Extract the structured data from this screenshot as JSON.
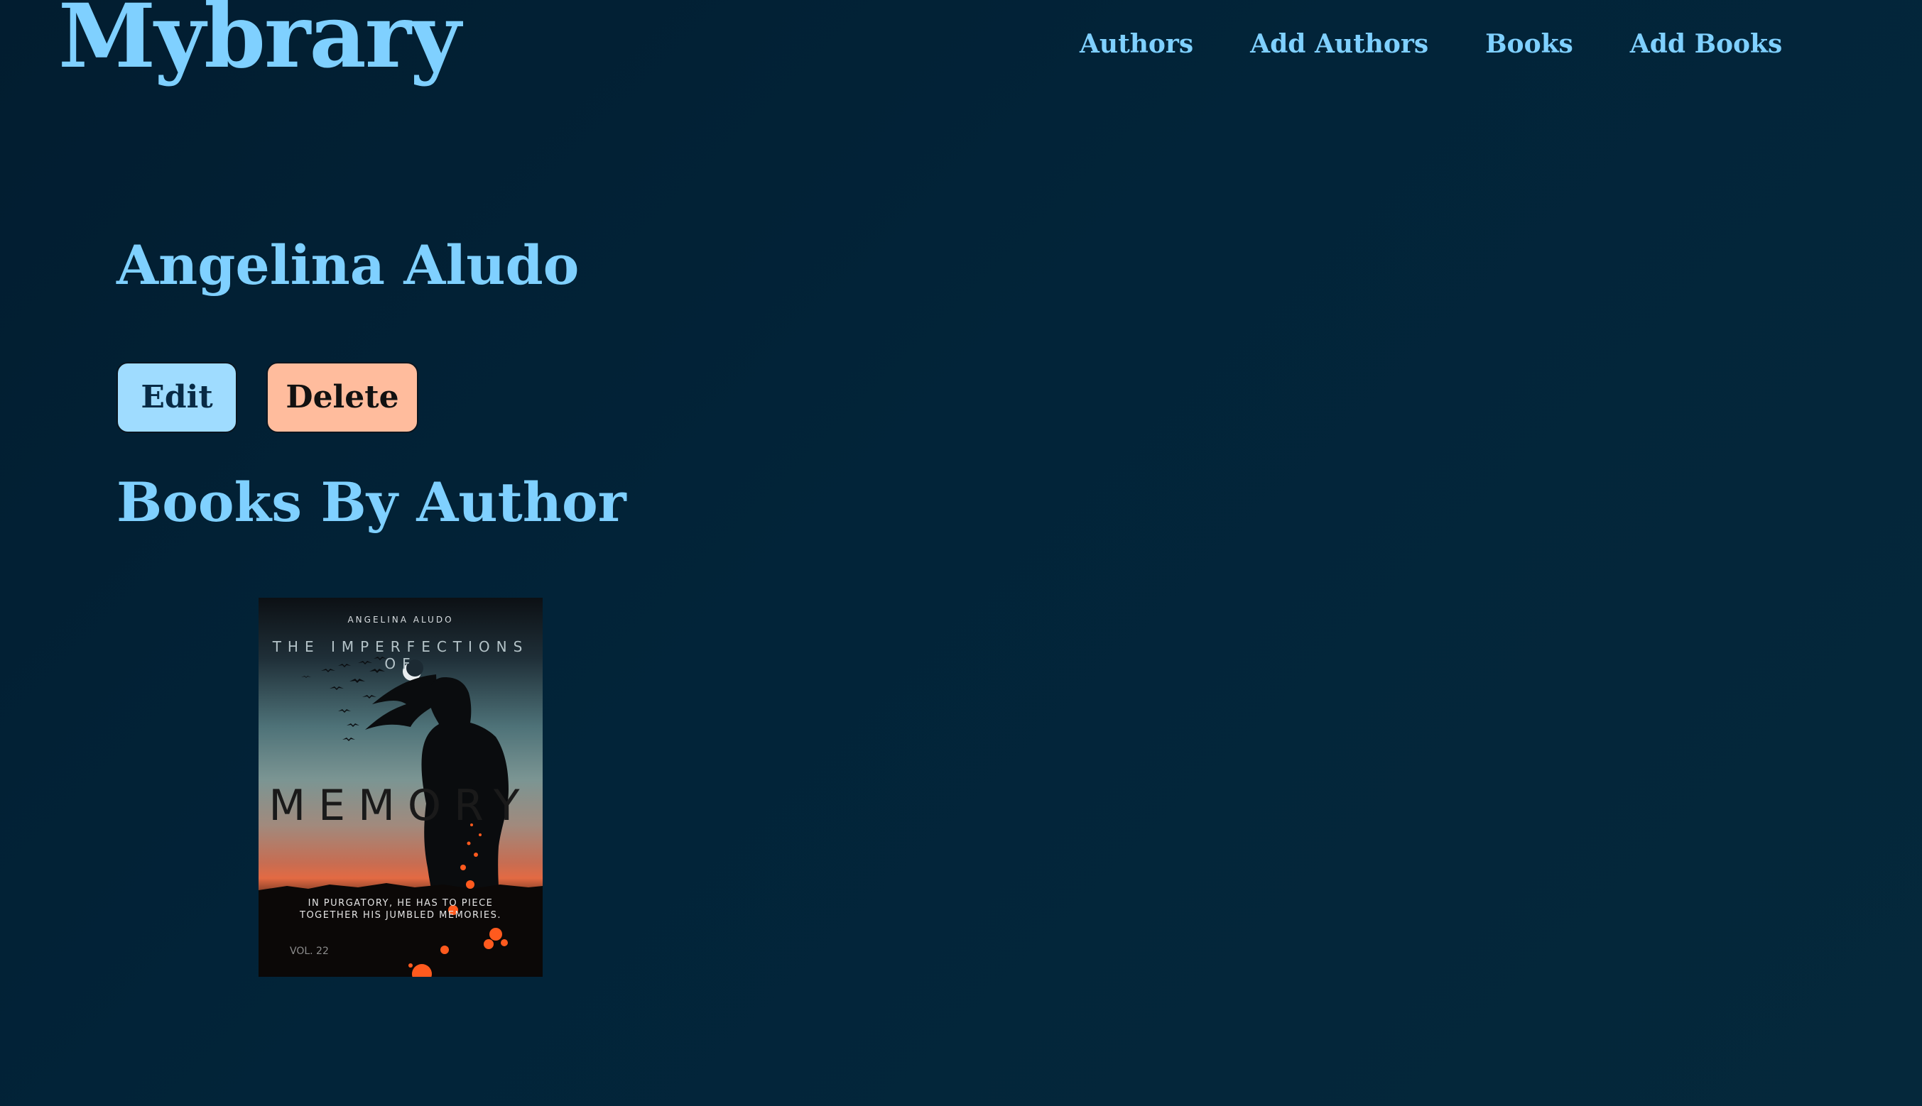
{
  "brand": {
    "name": "Mybrary"
  },
  "nav": {
    "items": [
      {
        "label": "Authors"
      },
      {
        "label": "Add Authors"
      },
      {
        "label": "Books"
      },
      {
        "label": "Add Books"
      }
    ]
  },
  "author": {
    "name": "Angelina Aludo",
    "edit_label": "Edit",
    "delete_label": "Delete"
  },
  "books_section": {
    "title": "Books By Author",
    "books": [
      {
        "cover": {
          "author_line": "ANGELINA ALUDO",
          "series_line": "THE IMPERFECTIONS OF",
          "title": "MEMORY",
          "tagline_line1": "IN PURGATORY, HE HAS TO PIECE",
          "tagline_line2": "TOGETHER HIS JUMBLED MEMORIES.",
          "volume": "VOL. 22"
        }
      }
    ]
  },
  "colors": {
    "background": "#022439",
    "accent": "#7fd0ff",
    "edit_button": "#9fdcff",
    "delete_button": "#ffbc9d"
  }
}
